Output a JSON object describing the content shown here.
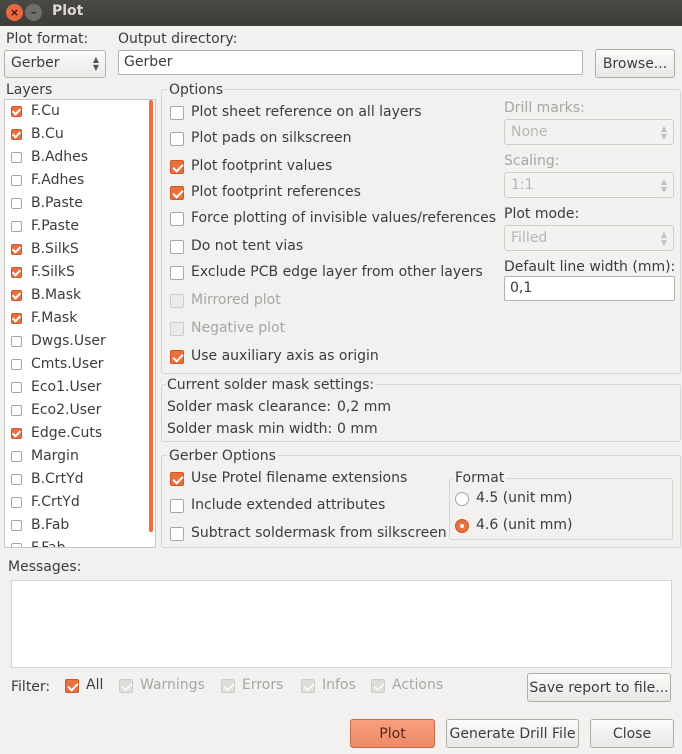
{
  "window": {
    "title": "Plot",
    "close_glyph": "×",
    "min_glyph": "–"
  },
  "plot_format": {
    "label": "Plot format:",
    "value": "Gerber"
  },
  "output_directory": {
    "label": "Output directory:",
    "value": "Gerber",
    "browse_label": "Browse..."
  },
  "layers": {
    "title": "Layers",
    "items": [
      {
        "name": "F.Cu",
        "checked": true
      },
      {
        "name": "B.Cu",
        "checked": true
      },
      {
        "name": "B.Adhes",
        "checked": false
      },
      {
        "name": "F.Adhes",
        "checked": false
      },
      {
        "name": "B.Paste",
        "checked": false
      },
      {
        "name": "F.Paste",
        "checked": false
      },
      {
        "name": "B.SilkS",
        "checked": true
      },
      {
        "name": "F.SilkS",
        "checked": true
      },
      {
        "name": "B.Mask",
        "checked": true
      },
      {
        "name": "F.Mask",
        "checked": true
      },
      {
        "name": "Dwgs.User",
        "checked": false
      },
      {
        "name": "Cmts.User",
        "checked": false
      },
      {
        "name": "Eco1.User",
        "checked": false
      },
      {
        "name": "Eco2.User",
        "checked": false
      },
      {
        "name": "Edge.Cuts",
        "checked": true
      },
      {
        "name": "Margin",
        "checked": false
      },
      {
        "name": "B.CrtYd",
        "checked": false
      },
      {
        "name": "F.CrtYd",
        "checked": false
      },
      {
        "name": "B.Fab",
        "checked": false
      },
      {
        "name": "F.Fab",
        "checked": false
      }
    ]
  },
  "options": {
    "title": "Options",
    "items": [
      {
        "label": "Plot sheet reference on all layers",
        "checked": false,
        "disabled": false
      },
      {
        "label": "Plot pads on silkscreen",
        "checked": false,
        "disabled": false
      },
      {
        "label": "Plot footprint values",
        "checked": true,
        "disabled": false
      },
      {
        "label": "Plot footprint references",
        "checked": true,
        "disabled": false
      },
      {
        "label": "Force plotting of invisible values/references",
        "checked": false,
        "disabled": false
      },
      {
        "label": "Do not tent vias",
        "checked": false,
        "disabled": false
      },
      {
        "label": "Exclude PCB edge layer from other layers",
        "checked": false,
        "disabled": false
      },
      {
        "label": "Mirrored plot",
        "checked": false,
        "disabled": true
      },
      {
        "label": "Negative plot",
        "checked": false,
        "disabled": true
      },
      {
        "label": "Use auxiliary axis as origin",
        "checked": true,
        "disabled": false
      }
    ],
    "drill_marks": {
      "label": "Drill marks:",
      "value": "None"
    },
    "scaling": {
      "label": "Scaling:",
      "value": "1:1"
    },
    "plot_mode": {
      "label": "Plot mode:",
      "value": "Filled"
    },
    "default_line_width": {
      "label": "Default line width (mm):",
      "value": "0,1"
    }
  },
  "solder_mask": {
    "title": "Current solder mask settings:",
    "clearance_label": "Solder mask clearance:",
    "clearance_value": "0,2 mm",
    "min_width_label": "Solder mask min width:",
    "min_width_value": "0 mm"
  },
  "gerber_options": {
    "title": "Gerber Options",
    "items": [
      {
        "label": "Use Protel filename extensions",
        "checked": true
      },
      {
        "label": "Include extended attributes",
        "checked": false
      },
      {
        "label": "Subtract soldermask from silkscreen",
        "checked": false
      }
    ],
    "format": {
      "title": "Format",
      "options": [
        {
          "label": "4.5 (unit mm)",
          "selected": false
        },
        {
          "label": "4.6 (unit mm)",
          "selected": true
        }
      ]
    }
  },
  "messages": {
    "label": "Messages:"
  },
  "filter": {
    "label": "Filter:",
    "items": [
      {
        "label": "All",
        "checked": true,
        "disabled": false
      },
      {
        "label": "Warnings",
        "checked": true,
        "disabled": true
      },
      {
        "label": "Errors",
        "checked": true,
        "disabled": true
      },
      {
        "label": "Infos",
        "checked": true,
        "disabled": true
      },
      {
        "label": "Actions",
        "checked": true,
        "disabled": true
      }
    ],
    "save_report_label": "Save report to file..."
  },
  "buttons": {
    "plot": "Plot",
    "generate_drill": "Generate Drill File",
    "close": "Close"
  },
  "colors": {
    "accent": "#e9713e",
    "titlebar": "#3c3b37",
    "background": "#f2f1f0"
  }
}
